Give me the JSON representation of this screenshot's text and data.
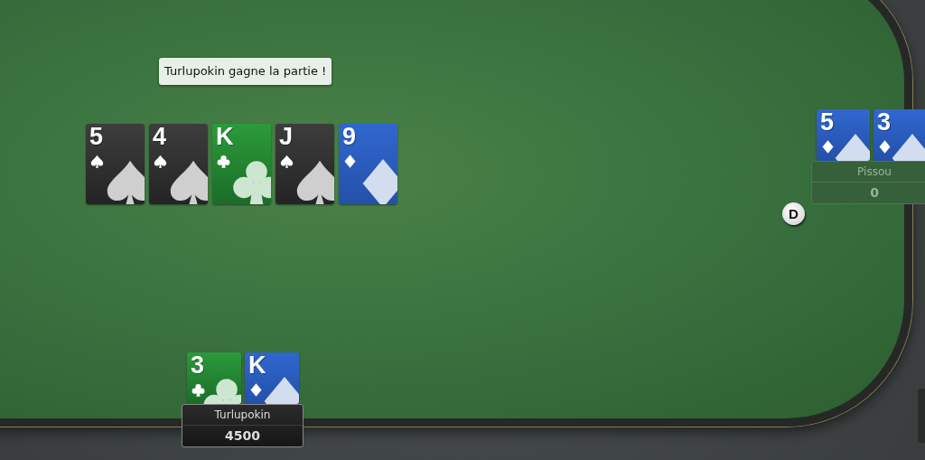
{
  "message": "Turlupokin gagne la partie !",
  "board": [
    {
      "rank": "5",
      "kind": "spade"
    },
    {
      "rank": "4",
      "kind": "spade"
    },
    {
      "rank": "K",
      "kind": "club"
    },
    {
      "rank": "J",
      "kind": "spade"
    },
    {
      "rank": "9",
      "kind": "diamond"
    }
  ],
  "dealer_button": {
    "label": "D"
  },
  "players": [
    {
      "name": "Pissou",
      "chips": "0",
      "active": false,
      "cards": [
        {
          "rank": "5",
          "kind": "diamond"
        },
        {
          "rank": "3",
          "kind": "diamond"
        }
      ]
    },
    {
      "name": "Turlupokin",
      "chips": "4500",
      "active": true,
      "cards": [
        {
          "rank": "3",
          "kind": "club"
        },
        {
          "rank": "K",
          "kind": "diamond"
        }
      ]
    }
  ]
}
